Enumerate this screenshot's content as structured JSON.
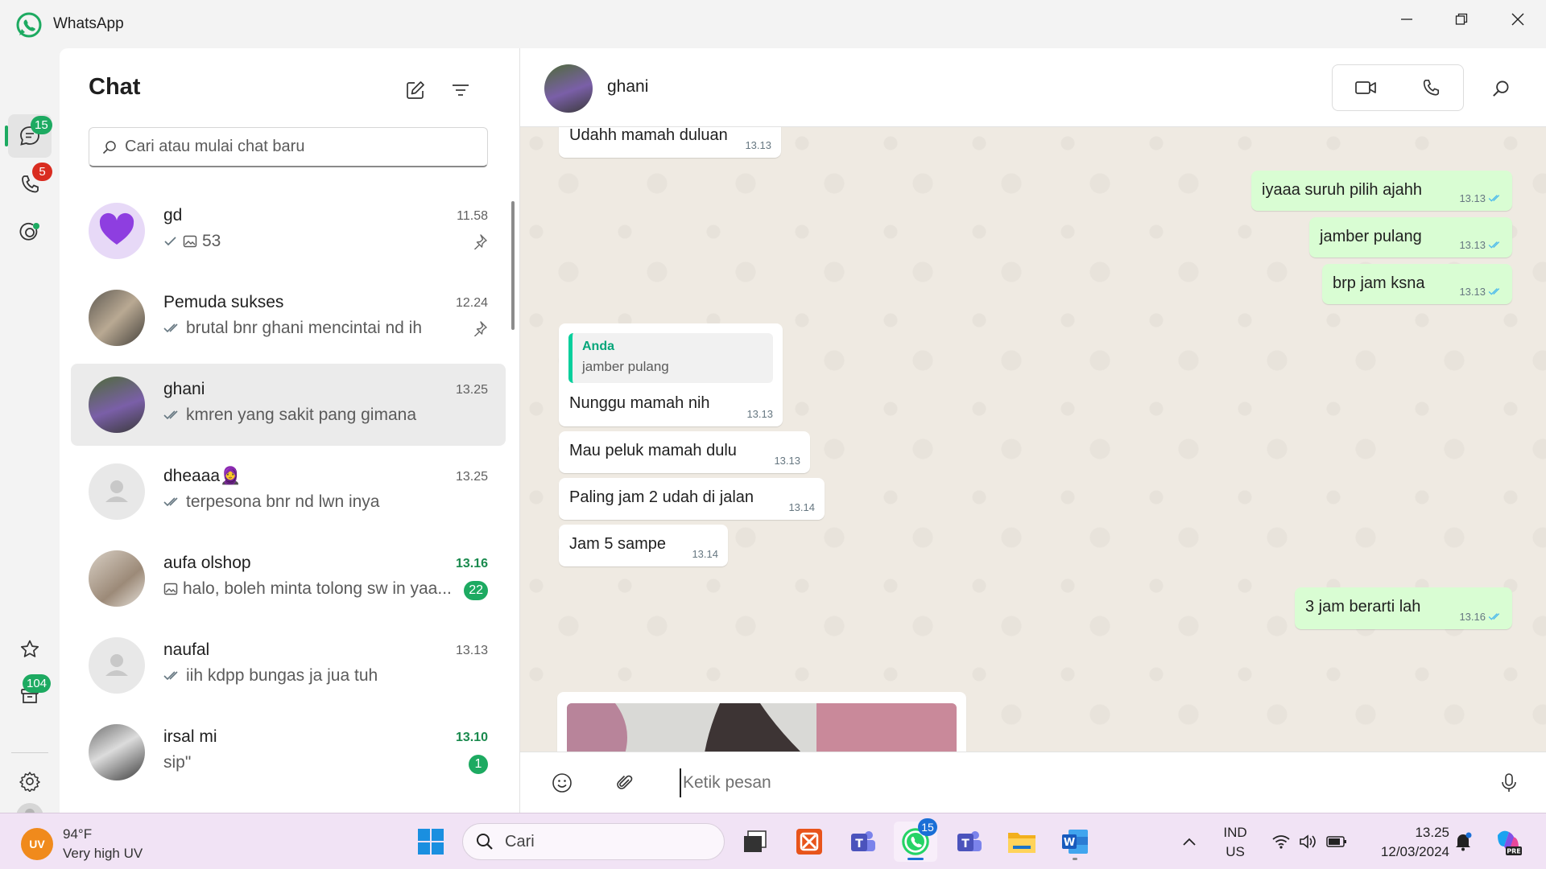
{
  "window": {
    "app_name": "WhatsApp"
  },
  "rail": {
    "chats_badge": "15",
    "calls_badge": "5",
    "archive_badge": "104"
  },
  "chat_list": {
    "title": "Chat",
    "search_placeholder": "Cari atau mulai chat baru",
    "chats": [
      {
        "name": "gd",
        "time": "11.58",
        "preview": "53",
        "pinned": true,
        "unread": "",
        "status": "sent"
      },
      {
        "name": "Pemuda sukses",
        "time": "12.24",
        "preview": "brutal bnr ghani mencintai nd ih",
        "pinned": true,
        "unread": "",
        "status": "read"
      },
      {
        "name": "ghani",
        "time": "13.25",
        "preview": "kmren yang sakit pang gimana",
        "pinned": false,
        "unread": "",
        "status": "read"
      },
      {
        "name": "dheaaa🧕",
        "time": "13.25",
        "preview": "terpesona bnr nd lwn inya",
        "pinned": false,
        "unread": "",
        "status": "read"
      },
      {
        "name": "aufa olshop",
        "time": "13.16",
        "preview": "halo, boleh minta tolong sw in yaa...",
        "pinned": false,
        "unread": "22",
        "status": "photo"
      },
      {
        "name": "naufal",
        "time": "13.13",
        "preview": "iih kdpp bungas ja jua tuh",
        "pinned": false,
        "unread": "",
        "status": "read"
      },
      {
        "name": "irsal mi",
        "time": "13.10",
        "preview": "sip\"",
        "pinned": false,
        "unread": "1",
        "status": "none"
      }
    ]
  },
  "conversation": {
    "contact_name": "ghani",
    "messages": [
      {
        "dir": "in",
        "text": "Udahh mamah duluan",
        "time": "13.13"
      },
      {
        "dir": "out",
        "text": "iyaaa suruh pilih ajahh",
        "time": "13.13"
      },
      {
        "dir": "out",
        "text": "jamber pulang",
        "time": "13.13"
      },
      {
        "dir": "out",
        "text": "brp jam ksna",
        "time": "13.13"
      },
      {
        "dir": "in",
        "text": "Nunggu mamah nih",
        "time": "13.13",
        "quote_author": "Anda",
        "quote_text": "jamber pulang"
      },
      {
        "dir": "in",
        "text": "Mau peluk mamah dulu",
        "time": "13.13"
      },
      {
        "dir": "in",
        "text": "Paling jam 2 udah di jalan",
        "time": "13.14"
      },
      {
        "dir": "in",
        "text": "Jam 5 sampe",
        "time": "13.14"
      },
      {
        "dir": "out",
        "text": "3 jam berarti lah",
        "time": "13.16"
      }
    ],
    "composer_placeholder": "Ketik pesan"
  },
  "taskbar": {
    "temperature": "94°F",
    "weather_desc": "Very high UV",
    "uv_label": "UV",
    "search_placeholder": "Cari",
    "whatsapp_badge": "15",
    "lang_line1": "IND",
    "lang_line2": "US",
    "time": "13.25",
    "date": "12/03/2024",
    "copilot_label": "PRE"
  },
  "colors": {
    "accent_green": "#1daa61",
    "outgoing_bubble": "#d9fdd3",
    "read_tick": "#53bdeb",
    "badge_red": "#d92c20"
  }
}
